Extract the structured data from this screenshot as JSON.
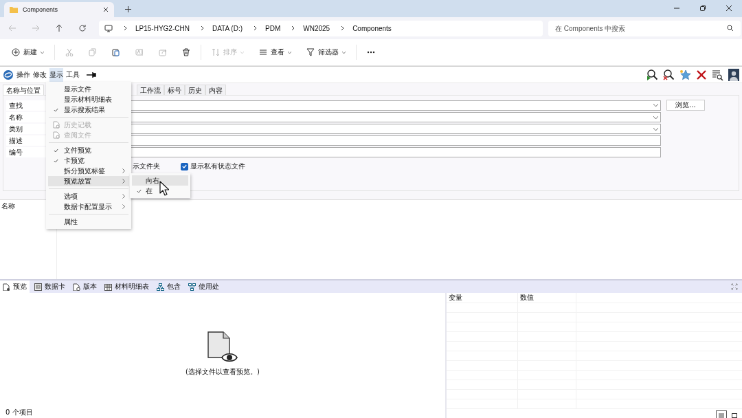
{
  "window": {
    "tab_title": "Components"
  },
  "address": {
    "crumbs": [
      "LP15-HYG2-CHN",
      "DATA (D:)",
      "PDM",
      "WN2025",
      "Components"
    ],
    "search_placeholder": "在 Components 中搜索"
  },
  "commands": [
    {
      "kind": "new",
      "label": "新建",
      "disabled": false,
      "dropdown": true
    },
    {
      "kind": "cut",
      "disabled": true
    },
    {
      "kind": "copy",
      "disabled": true
    },
    {
      "kind": "paste",
      "disabled": false
    },
    {
      "kind": "rename",
      "disabled": true
    },
    {
      "kind": "share",
      "disabled": true
    },
    {
      "kind": "delete",
      "disabled": false
    },
    {
      "kind": "sort",
      "label": "排序",
      "disabled": true,
      "dropdown": true
    },
    {
      "kind": "view",
      "label": "查看",
      "disabled": false,
      "dropdown": true
    },
    {
      "kind": "filter",
      "label": "筛选器",
      "disabled": false,
      "dropdown": true
    },
    {
      "kind": "more",
      "disabled": false
    }
  ],
  "menubar": [
    {
      "label": "操作",
      "selected": false
    },
    {
      "label": "修改",
      "selected": false
    },
    {
      "label": "显示",
      "selected": true
    },
    {
      "label": "工具",
      "selected": false
    }
  ],
  "display_menu": [
    {
      "kind": "item",
      "label": "显示文件",
      "checked": false,
      "disabled": false,
      "submenu": false,
      "selected": false
    },
    {
      "kind": "item",
      "label": "显示材料明细表",
      "checked": false,
      "disabled": false,
      "submenu": false,
      "selected": false
    },
    {
      "kind": "item",
      "label": "显示搜索结果",
      "checked": true,
      "disabled": false,
      "submenu": false,
      "selected": false
    },
    {
      "kind": "separator"
    },
    {
      "kind": "item",
      "label": "历史记载",
      "checked": false,
      "disabled": true,
      "submenu": false,
      "selected": false
    },
    {
      "kind": "item",
      "label": "查阅文件",
      "checked": false,
      "disabled": true,
      "submenu": false,
      "selected": false
    },
    {
      "kind": "separator"
    },
    {
      "kind": "item",
      "label": "文件预览",
      "checked": true,
      "disabled": false,
      "submenu": false,
      "selected": false
    },
    {
      "kind": "item",
      "label": "卡预览",
      "checked": true,
      "disabled": false,
      "submenu": false,
      "selected": false
    },
    {
      "kind": "item",
      "label": "拆分预览标签",
      "checked": false,
      "disabled": false,
      "submenu": true,
      "selected": false
    },
    {
      "kind": "item",
      "label": "预览放置",
      "checked": false,
      "disabled": false,
      "submenu": true,
      "selected": true
    },
    {
      "kind": "separator"
    },
    {
      "kind": "item",
      "label": "选项",
      "checked": false,
      "disabled": false,
      "submenu": true,
      "selected": false
    },
    {
      "kind": "item",
      "label": "数据卡配置显示",
      "checked": false,
      "disabled": false,
      "submenu": true,
      "selected": false
    },
    {
      "kind": "separator"
    },
    {
      "kind": "item",
      "label": "属性",
      "checked": false,
      "disabled": false,
      "submenu": false,
      "selected": false
    }
  ],
  "placement_submenu": [
    {
      "label": "向右",
      "checked": false,
      "selected": true
    },
    {
      "label": "在",
      "checked": true,
      "selected": false
    }
  ],
  "search_tabs_left": [
    {
      "label": "名称与位置",
      "selected": true
    }
  ],
  "search_tabs_right": [
    {
      "label": "工作流",
      "selected": false
    },
    {
      "label": "标号",
      "selected": false
    },
    {
      "label": "历史",
      "selected": false
    },
    {
      "label": "内容",
      "selected": false
    }
  ],
  "search_fields": [
    {
      "label": "查找",
      "kind": "dropdown"
    },
    {
      "label": "名称",
      "kind": "dropdown"
    },
    {
      "label": "类别",
      "kind": "dropdown"
    },
    {
      "label": "描述",
      "kind": "text"
    },
    {
      "label": "编号",
      "kind": "text"
    }
  ],
  "browse_button": "浏览...",
  "partial_option": "示文件夹",
  "options": [
    {
      "label": "显示私有状态文件",
      "checked": true
    }
  ],
  "results": {
    "columns": [
      "名称"
    ]
  },
  "bottom_tabs": [
    {
      "label": "预览",
      "selected": true
    },
    {
      "label": "数据卡",
      "selected": false
    },
    {
      "label": "版本",
      "selected": false
    },
    {
      "label": "材料明细表",
      "selected": false
    },
    {
      "label": "包含",
      "selected": false
    },
    {
      "label": "使用处",
      "selected": false
    }
  ],
  "preview": {
    "message": "(选择文件以查看预览。)"
  },
  "variables": {
    "columns": [
      "变量",
      "数值"
    ]
  },
  "status": "0 个项目",
  "view_buttons": [
    {
      "kind": "details",
      "selected": true
    },
    {
      "kind": "tiles",
      "selected": false
    }
  ]
}
